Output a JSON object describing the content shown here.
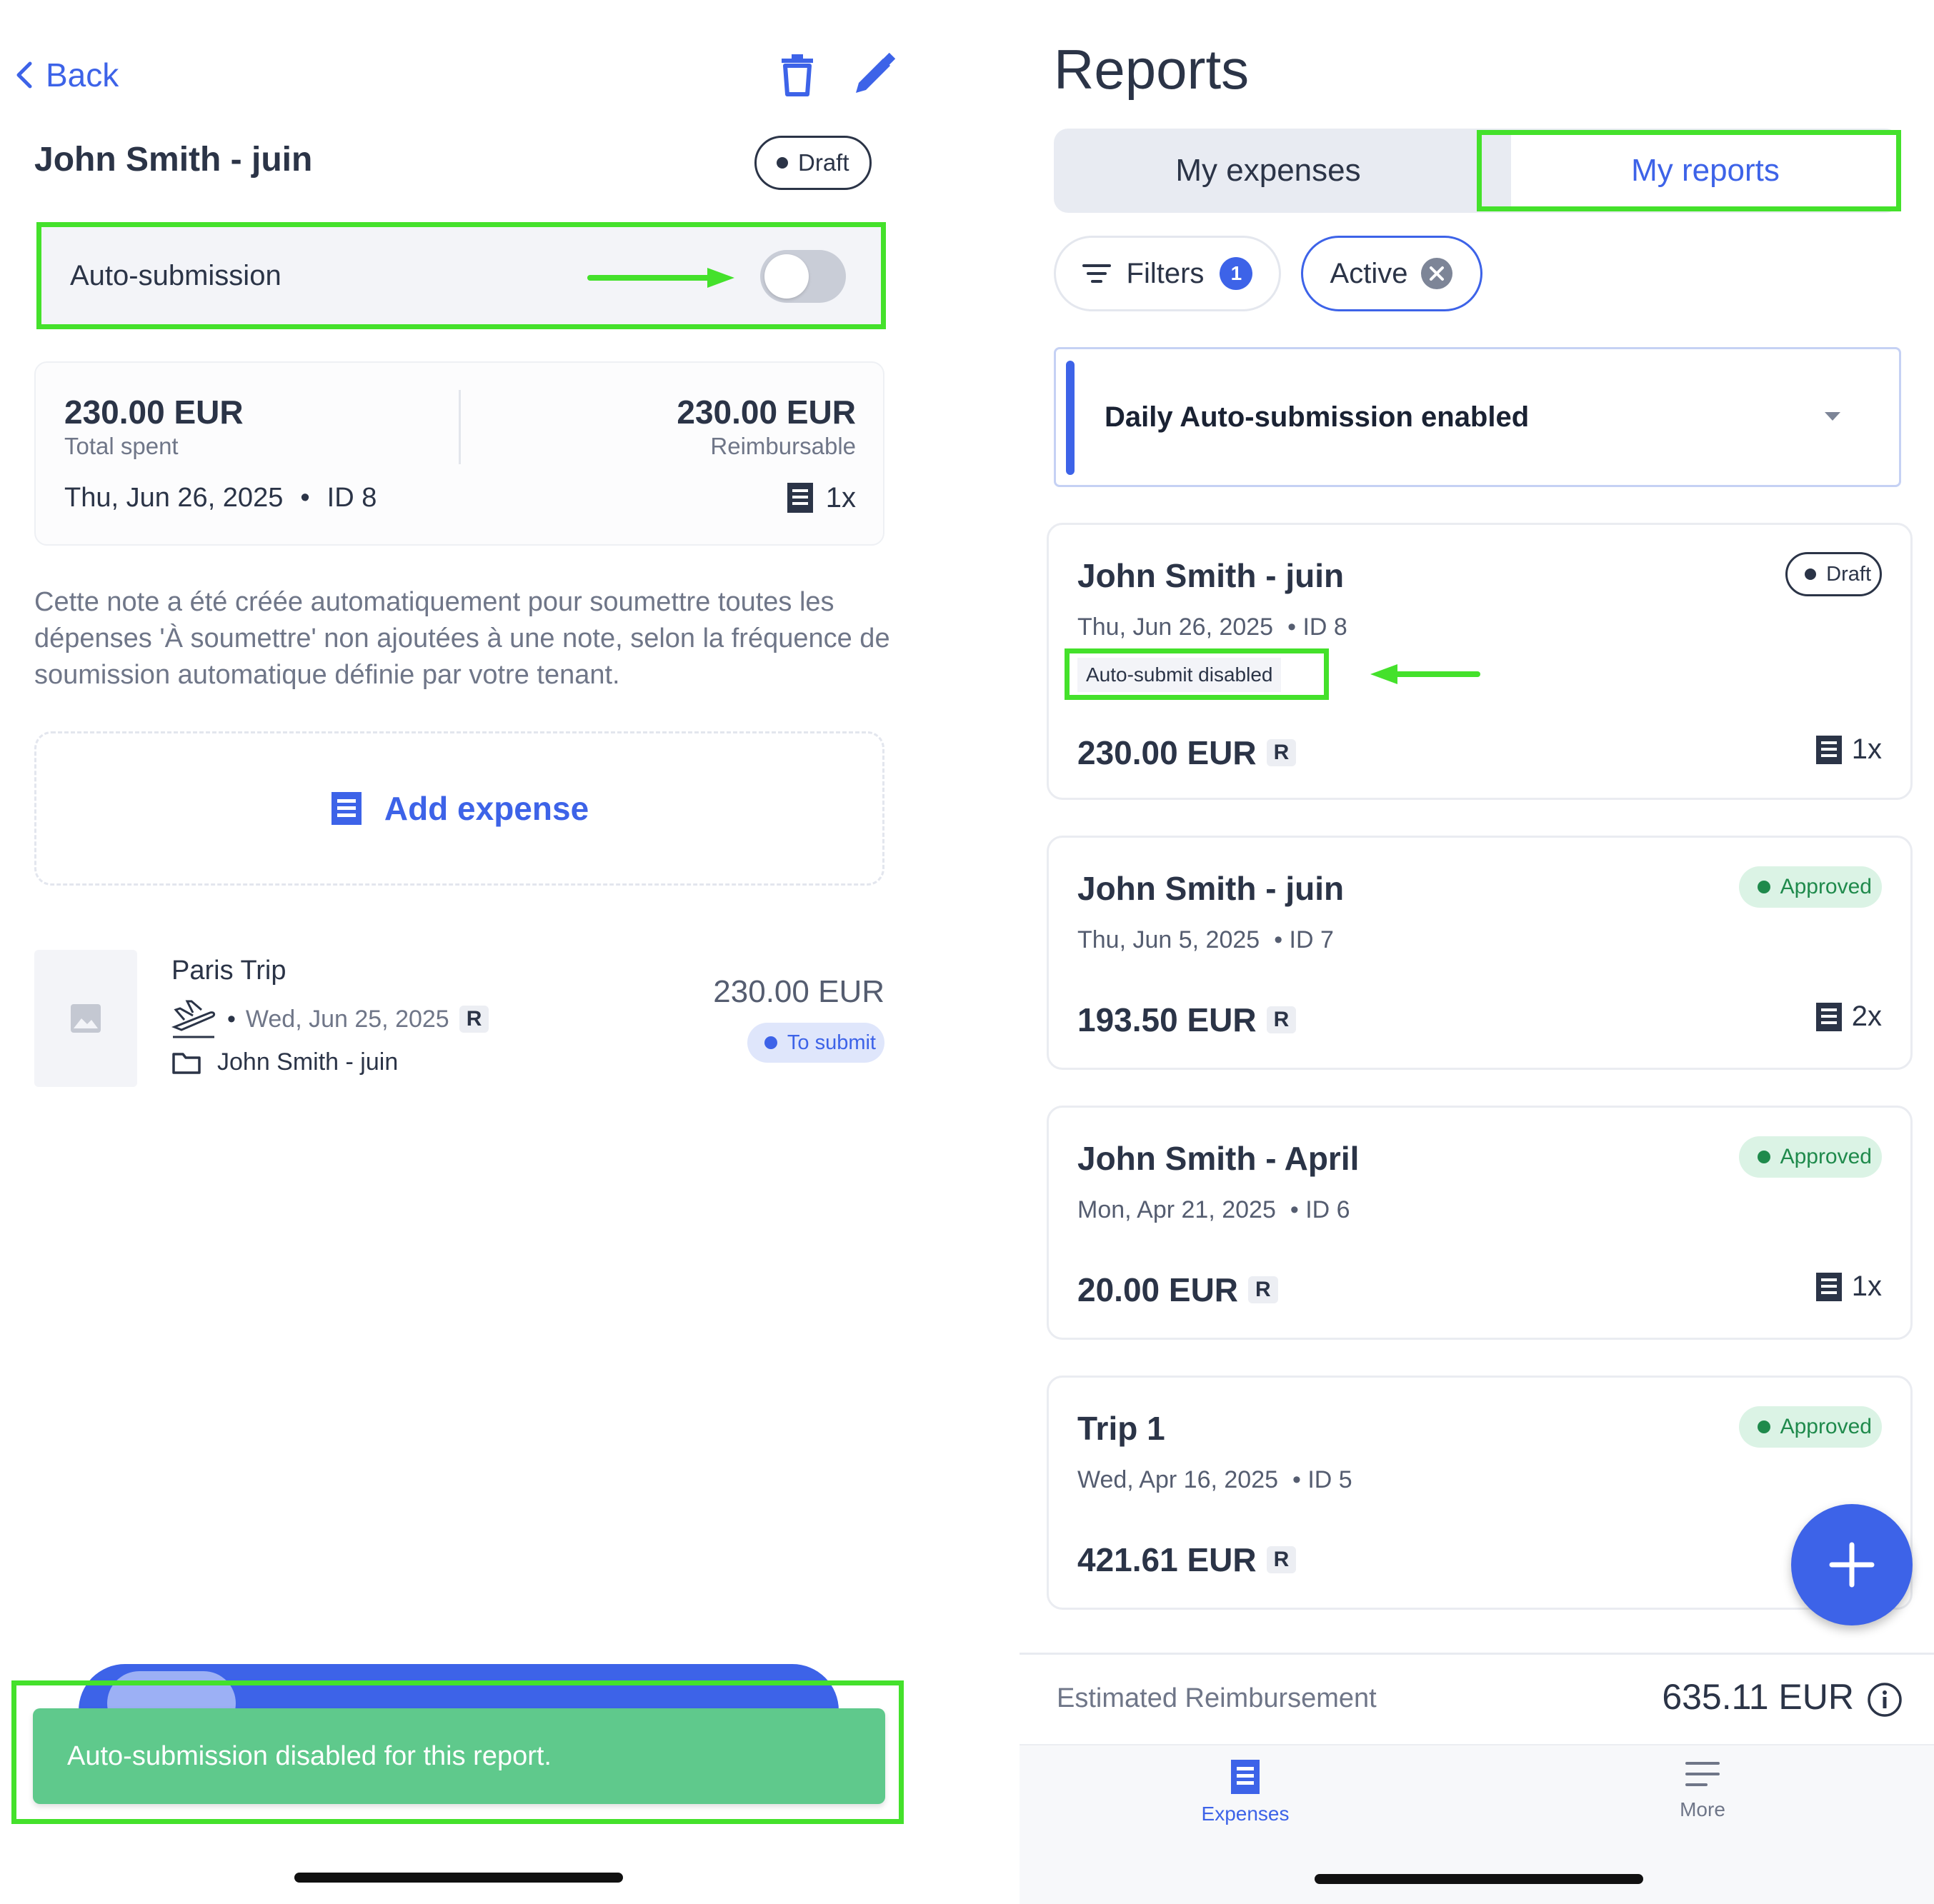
{
  "left": {
    "back_label": "Back",
    "report_title": "John Smith - juin",
    "status": "Draft",
    "auto_submission_label": "Auto-submission",
    "auto_submission_enabled": false,
    "total_spent_amount": "230.00 EUR",
    "total_spent_label": "Total spent",
    "reimbursable_amount": "230.00 EUR",
    "reimbursable_label": "Reimbursable",
    "date": "Thu, Jun 26, 2025",
    "id_label": "ID 8",
    "receipt_count": "1x",
    "description": "Cette note a été créée automatiquement pour soumettre toutes les dépenses 'À soumettre' non ajoutées à une note, selon la fréquence de soumission automatique définie par votre tenant.",
    "add_expense_label": "Add expense",
    "expense": {
      "title": "Paris Trip",
      "date": "Wed, Jun 25, 2025",
      "badge": "R",
      "report": "John Smith - juin",
      "amount": "230.00 EUR",
      "status": "To submit"
    },
    "toast": "Auto-submission disabled for this report."
  },
  "right": {
    "title": "Reports",
    "tabs": [
      {
        "label": "My expenses",
        "active": false
      },
      {
        "label": "My reports",
        "active": true
      }
    ],
    "filters_label": "Filters",
    "filters_count": "1",
    "active_chip": "Active",
    "banner": "Daily Auto-submission enabled",
    "reports": [
      {
        "title": "John Smith - juin",
        "date": "Thu, Jun 26, 2025",
        "id": "• ID 8",
        "status": "Draft",
        "note": "Auto-submit disabled",
        "amount": "230.00 EUR",
        "badge": "R",
        "count": "1x"
      },
      {
        "title": "John Smith - juin",
        "date": "Thu, Jun 5, 2025",
        "id": "• ID 7",
        "status": "Approved",
        "amount": "193.50 EUR",
        "badge": "R",
        "count": "2x"
      },
      {
        "title": "John Smith - April",
        "date": "Mon, Apr 21, 2025",
        "id": "• ID 6",
        "status": "Approved",
        "amount": "20.00 EUR",
        "badge": "R",
        "count": "1x"
      },
      {
        "title": "Trip 1",
        "date": "Wed, Apr 16, 2025",
        "id": "• ID 5",
        "status": "Approved",
        "amount": "421.61 EUR",
        "badge": "R"
      }
    ],
    "estimated_label": "Estimated Reimbursement",
    "estimated_amount": "635.11 EUR",
    "nav": [
      {
        "label": "Expenses",
        "active": true
      },
      {
        "label": "More",
        "active": false
      }
    ]
  },
  "colors": {
    "accent": "#3d63e8",
    "highlight": "#44e12b",
    "toast": "#5fc98c",
    "approved": "#1f8a4c"
  },
  "icons": [
    "chevron-left-icon",
    "trash-icon",
    "pencil-icon",
    "receipt-icon",
    "image-icon",
    "plane-icon",
    "folder-icon",
    "filter-icon",
    "close-circle-icon",
    "caret-down-icon",
    "plus-icon",
    "info-icon",
    "menu-icon"
  ]
}
